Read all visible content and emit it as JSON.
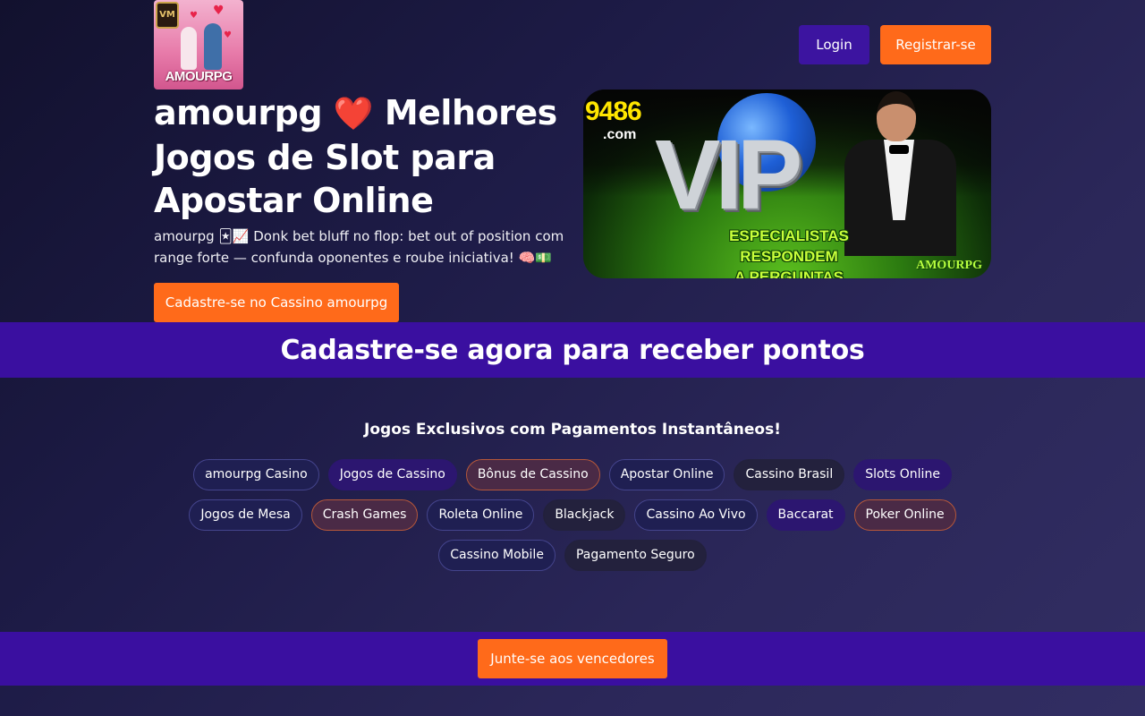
{
  "brand": {
    "logo_text": "AMOURPG",
    "logo_badge": "VM"
  },
  "header": {
    "login_label": "Login",
    "register_label": "Registrar-se"
  },
  "hero": {
    "title_part1": "amourpg",
    "title_heart": "❤️",
    "title_part2": "Melhores Jogos de Slot para Apostar Online",
    "description": "amourpg 🃏📈 Donk bet bluff no flop: bet out of position com range forte — confunda oponentes e roube iniciativa! 🧠💵",
    "cta_label": "Cadastre-se no Cassino amourpg"
  },
  "banner": {
    "site_number": "9486",
    "site_domain": ".com",
    "headline": "VIP",
    "caption_line1": "ESPECIALISTAS RESPONDEM",
    "caption_line2": "A PERGUNTAS FREQUENTES",
    "corner_brand": "AMOURPG"
  },
  "promo_strip": {
    "title": "Cadastre-se agora para receber pontos"
  },
  "games": {
    "heading": "Jogos Exclusivos com Pagamentos Instantâneos!",
    "tags": [
      {
        "label": "amourpg Casino",
        "style": "v-outline"
      },
      {
        "label": "Jogos de Cassino",
        "style": "v-purple"
      },
      {
        "label": "Bônus de Cassino",
        "style": "v-orange"
      },
      {
        "label": "Apostar Online",
        "style": "v-outline"
      },
      {
        "label": "Cassino Brasil",
        "style": "v-dark"
      },
      {
        "label": "Slots Online",
        "style": "v-purple"
      },
      {
        "label": "Jogos de Mesa",
        "style": "v-outline"
      },
      {
        "label": "Crash Games",
        "style": "v-orange"
      },
      {
        "label": "Roleta Online",
        "style": "v-outline"
      },
      {
        "label": "Blackjack",
        "style": "v-dark"
      },
      {
        "label": "Cassino Ao Vivo",
        "style": "v-outline"
      },
      {
        "label": "Baccarat",
        "style": "v-purple"
      },
      {
        "label": "Poker Online",
        "style": "v-orange"
      },
      {
        "label": "Cassino Mobile",
        "style": "v-outline"
      },
      {
        "label": "Pagamento Seguro",
        "style": "v-dark"
      }
    ]
  },
  "footer_cta": {
    "join_label": "Junte-se aos vencedores"
  },
  "colors": {
    "accent_orange": "#ff6a1a",
    "accent_purple": "#3a0fa0",
    "login_purple": "#3c14a0"
  }
}
